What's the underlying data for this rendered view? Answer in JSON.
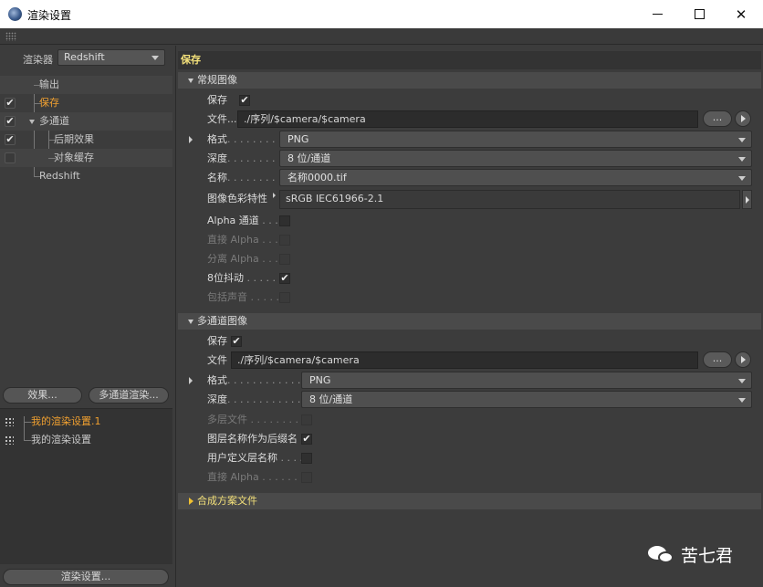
{
  "window": {
    "title": "渲染设置",
    "controls": {
      "minimize": "minimize-icon",
      "maximize": "maximize-icon",
      "close": "✕"
    }
  },
  "left": {
    "renderer_label": "渲染器",
    "renderer_value": "Redshift",
    "tree": [
      {
        "label": "输出",
        "checked": false,
        "active": false
      },
      {
        "label": "保存",
        "checked": true,
        "active": true
      },
      {
        "label": "多通道",
        "checked": true,
        "active": false
      },
      {
        "label": "后期效果",
        "checked": true,
        "active": false
      },
      {
        "label": "对象缓存",
        "checked": false,
        "active": false
      },
      {
        "label": "Redshift",
        "checked": false,
        "active": false
      }
    ],
    "effects_button": "效果...",
    "multipass_button": "多通道渲染...",
    "presets": [
      {
        "label": "我的渲染设置.1",
        "active": true
      },
      {
        "label": "我的渲染设置",
        "active": false
      }
    ],
    "render_settings_button": "渲染设置...",
    "check_mark": "✔"
  },
  "right": {
    "page_title": "保存",
    "regular": {
      "title": "常规图像",
      "save_label": "保存",
      "save_checked": true,
      "file_label": "文件...",
      "file_value": "./序列/$camera/$camera",
      "browse_label": "...",
      "format_label": "格式",
      "format_value": "PNG",
      "depth_label": "深度",
      "depth_value": "8 位/通道",
      "name_label": "名称",
      "name_value": "名称0000.tif",
      "profile_label": "图像色彩特性",
      "profile_value": "sRGB IEC61966-2.1",
      "alpha_label": "Alpha 通道",
      "straight_alpha_label": "直接 Alpha",
      "separate_alpha_label": "分离 Alpha",
      "dither_label": "8位抖动",
      "dither_checked": true,
      "sound_label": "包括声音"
    },
    "multipass": {
      "title": "多通道图像",
      "save_label": "保存",
      "save_checked": true,
      "file_label": "文件",
      "file_value": "./序列/$camera/$camera",
      "browse_label": "...",
      "format_label": "格式",
      "format_value": "PNG",
      "depth_label": "深度",
      "depth_value": "8 位/通道",
      "layer_file_label": "多层文件",
      "layer_name_suffix_label": "图层名称作为后缀名",
      "layer_name_suffix_checked": true,
      "user_layer_name_label": "用户定义层名称",
      "straight_alpha_label": "直接 Alpha"
    },
    "composite": {
      "title": "合成方案文件"
    },
    "dot_leader": ". . . . . . . . . . . .",
    "check_mark": "✔"
  },
  "watermark": {
    "text": "苦七君",
    "icon": "wechat-icon"
  },
  "colors": {
    "active_text": "#f0a030",
    "header_text": "#f3e07a",
    "panel_bg": "#3c3c3c"
  }
}
